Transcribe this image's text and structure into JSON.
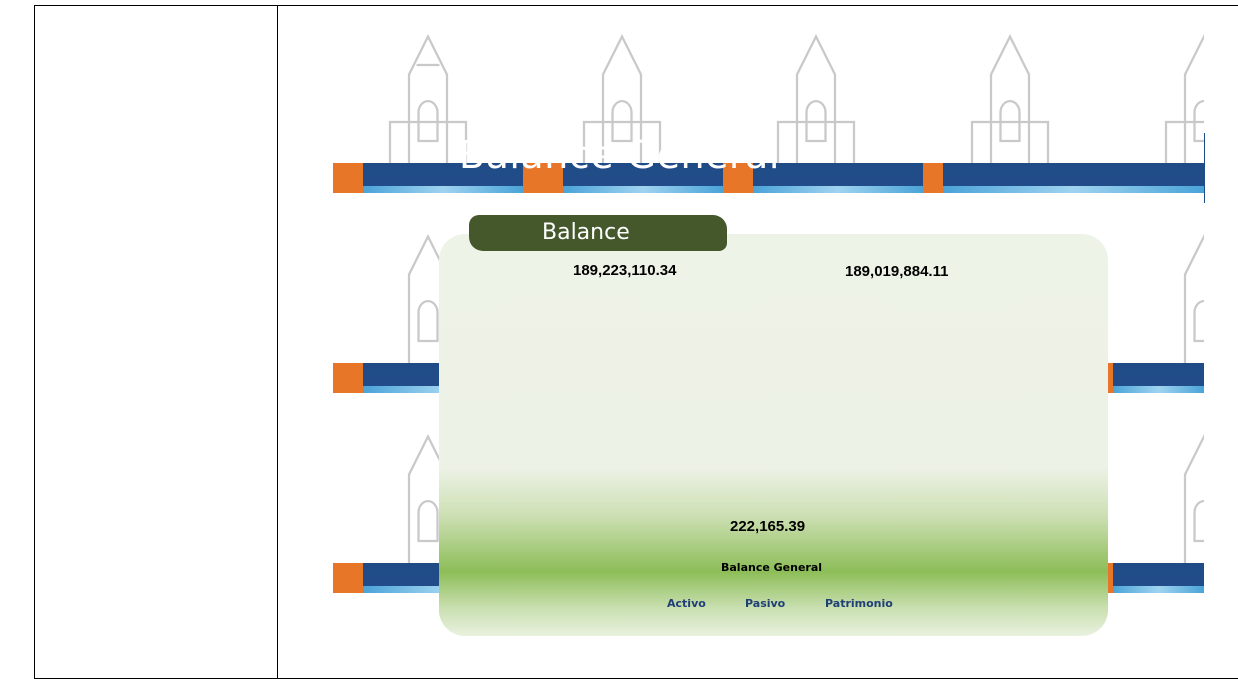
{
  "header": {
    "banner_title": "Balance General"
  },
  "panel": {
    "pill_label": "Balance",
    "activo_value": "189,223,110.34",
    "pasivo_value": "189,019,884.11",
    "patrimonio_value": "222,165.39",
    "subtitle": "Balance General"
  },
  "nav": {
    "activo": "Activo",
    "pasivo": "Pasivo",
    "patrimonio": "Patrimonio"
  },
  "colors": {
    "pill": "#44582c",
    "link": "#1f3f78",
    "banner_orange": "#e87628",
    "banner_blue": "#1f4b86"
  }
}
